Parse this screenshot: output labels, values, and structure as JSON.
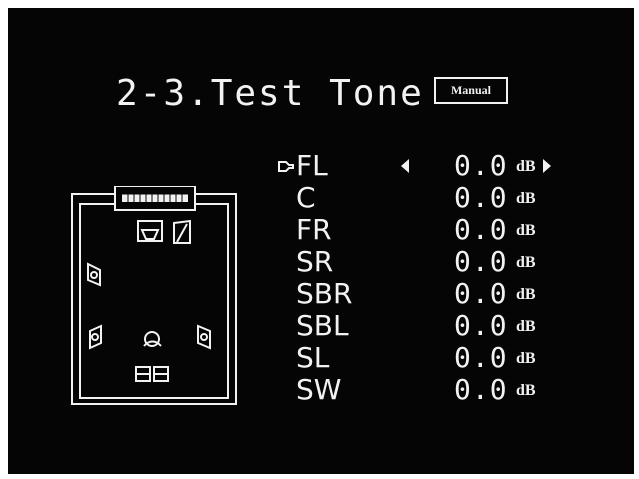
{
  "screen": {
    "title": "2-3.Test Tone",
    "mode_badge": "Manual"
  },
  "cursor": {
    "icon": "pointer-hand-icon"
  },
  "channels": [
    {
      "name": "FL",
      "value": "0.0",
      "unit": "dB",
      "selected": true
    },
    {
      "name": "C",
      "value": "0.0",
      "unit": "dB",
      "selected": false
    },
    {
      "name": "FR",
      "value": "0.0",
      "unit": "dB",
      "selected": false
    },
    {
      "name": "SR",
      "value": "0.0",
      "unit": "dB",
      "selected": false
    },
    {
      "name": "SBR",
      "value": "0.0",
      "unit": "dB",
      "selected": false
    },
    {
      "name": "SBL",
      "value": "0.0",
      "unit": "dB",
      "selected": false
    },
    {
      "name": "SL",
      "value": "0.0",
      "unit": "dB",
      "selected": false
    },
    {
      "name": "SW",
      "value": "0.0",
      "unit": "dB",
      "selected": false
    }
  ],
  "colors": {
    "screen_background": "#050505",
    "foreground": "#f2f2f2"
  }
}
